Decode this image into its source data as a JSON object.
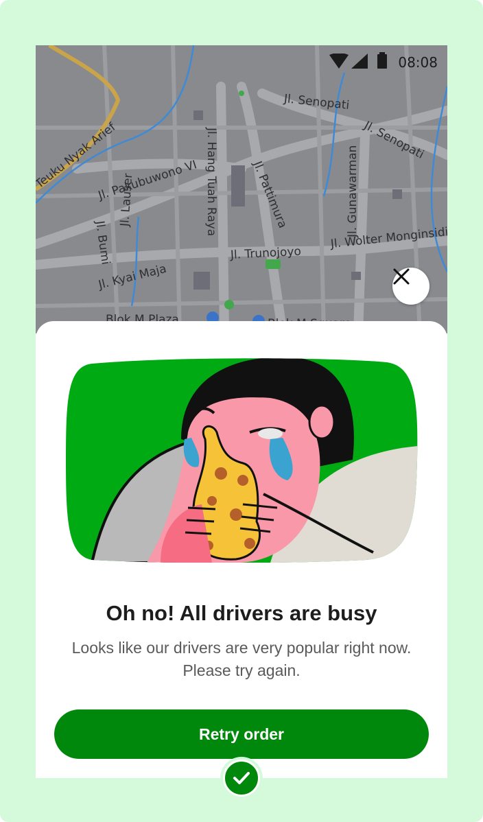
{
  "status_bar": {
    "time": "08:08",
    "icons": [
      "wifi-icon",
      "signal-icon",
      "battery-icon"
    ]
  },
  "map": {
    "labels": [
      "Teuku Nyak Arief",
      "Jl. Senopati",
      "Jl. Senopati",
      "Jl. Pakubuwono VI",
      "Jl. Hang Tuah Raya",
      "Jl. Pattimura",
      "Jl. Gunawarman",
      "Jl. Bumi",
      "Jl. Lauser",
      "Jl. Trunojoyo",
      "Jl. Wolter Monginsidi",
      "Jl. Kyai Maja",
      "Blok M Plaza",
      "Blok M Square"
    ]
  },
  "close_button": {
    "icon": "close-icon"
  },
  "sheet": {
    "title": "Oh no! All drivers are busy",
    "subtitle": "Looks like our drivers are very popular right now. Please try again.",
    "retry_label": "Retry order"
  },
  "badge": {
    "icon": "checkmark-icon"
  },
  "colors": {
    "brand_green": "#00880d",
    "illustration_green": "#00aa13",
    "frame_background": "#d5fadb",
    "map_background": "#888a8e"
  }
}
